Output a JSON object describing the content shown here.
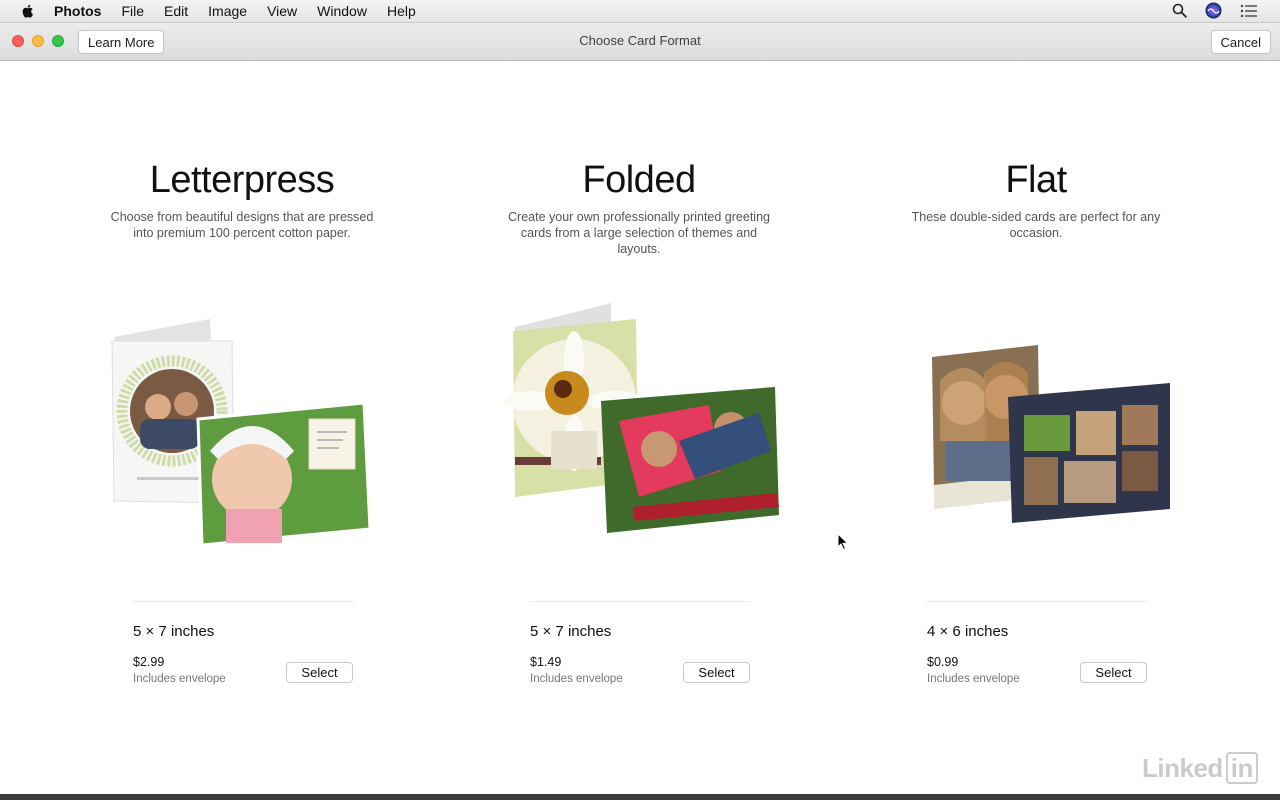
{
  "menubar": {
    "app": "Photos",
    "items": [
      "File",
      "Edit",
      "Image",
      "View",
      "Window",
      "Help"
    ],
    "right_icons": [
      "search-icon",
      "siri-icon",
      "notification-center-icon"
    ]
  },
  "window": {
    "title": "Choose Card Format",
    "learn_more_label": "Learn More",
    "cancel_label": "Cancel"
  },
  "cards": [
    {
      "title": "Letterpress",
      "description": "Choose from beautiful designs that are pressed into premium 100 percent cotton paper.",
      "size": "5 × 7 inches",
      "price": "$2.99",
      "note": "Includes envelope",
      "select_label": "Select"
    },
    {
      "title": "Folded",
      "description": "Create your own professionally printed greeting cards from a large selection of themes and layouts.",
      "size": "5 × 7 inches",
      "price": "$1.49",
      "note": "Includes envelope",
      "select_label": "Select"
    },
    {
      "title": "Flat",
      "description": "These double-sided cards are perfect for any occasion.",
      "size": "4 × 6 inches",
      "price": "$0.99",
      "note": "Includes envelope",
      "select_label": "Select"
    }
  ],
  "watermark": {
    "text": "Linked",
    "badge": "in"
  }
}
